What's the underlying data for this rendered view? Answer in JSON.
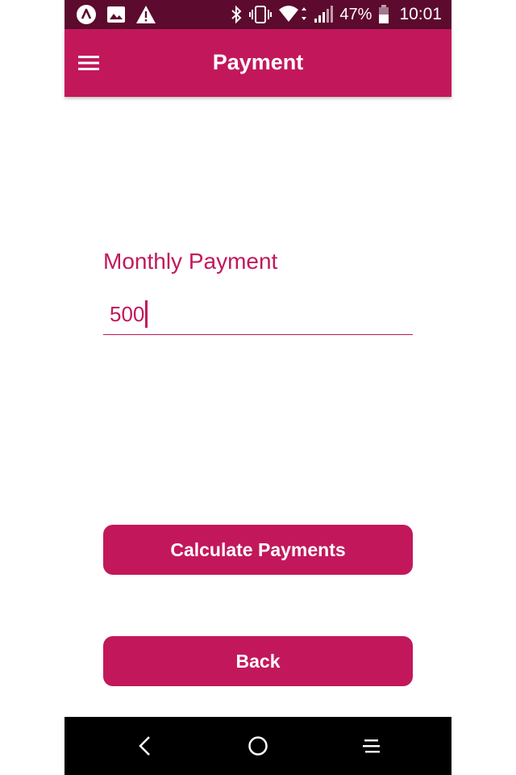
{
  "status_bar": {
    "battery_percent": "47%",
    "time": "10:01",
    "icons": [
      "app-notification-icon",
      "image-icon",
      "warning-icon",
      "bluetooth-icon",
      "vibrate-icon",
      "wifi-icon",
      "signal-icon",
      "battery-icon"
    ]
  },
  "app_bar": {
    "title": "Payment",
    "menu_icon": "hamburger-menu-icon"
  },
  "form": {
    "label": "Monthly Payment",
    "value": "500"
  },
  "buttons": {
    "calculate_label": "Calculate Payments",
    "back_label": "Back"
  },
  "nav_bar": {
    "icons": [
      "back-icon",
      "home-icon",
      "recents-icon"
    ]
  },
  "colors": {
    "primary": "#c2185b",
    "status_bar": "#5c0a2e",
    "nav_bar": "#000000",
    "background": "#ffffff"
  }
}
